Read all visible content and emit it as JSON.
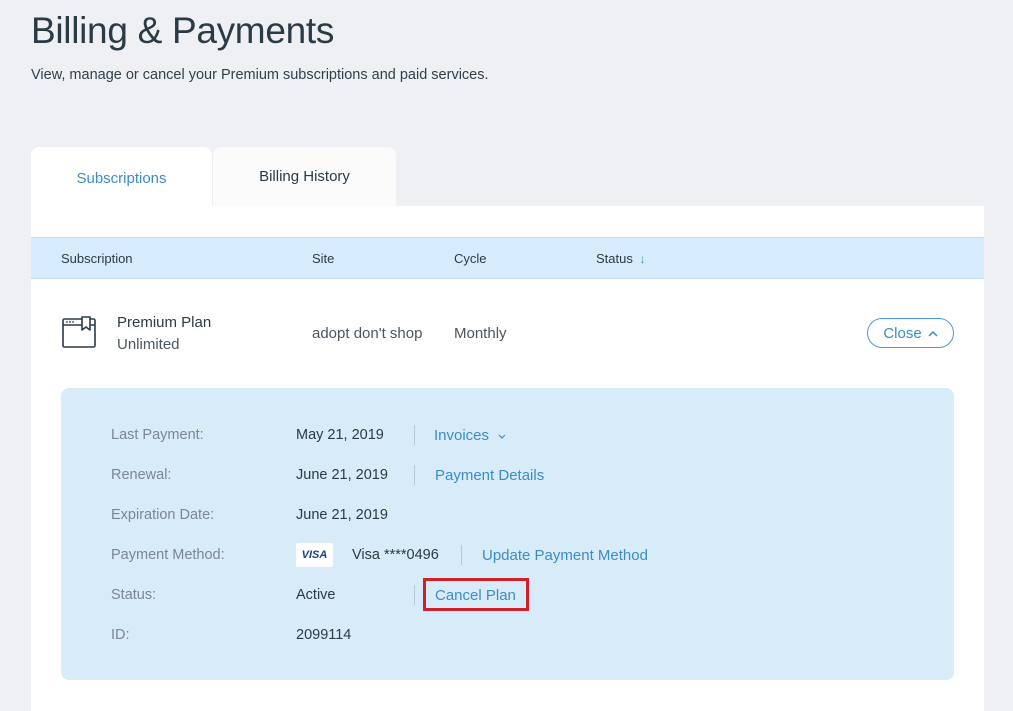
{
  "page": {
    "title": "Billing & Payments",
    "subtitle": "View, manage or cancel your Premium subscriptions and paid services."
  },
  "tabs": [
    {
      "label": "Subscriptions",
      "active": true
    },
    {
      "label": "Billing History",
      "active": false
    }
  ],
  "table": {
    "headers": {
      "subscription": "Subscription",
      "site": "Site",
      "cycle": "Cycle",
      "status": "Status",
      "status_sort_icon": "↓"
    },
    "row": {
      "icon": "browser-bookmark-icon",
      "plan_name": "Premium Plan",
      "plan_tier": "Unlimited",
      "site": "adopt don't shop",
      "cycle": "Monthly",
      "close_label": "Close"
    }
  },
  "details": {
    "last_payment_label": "Last Payment:",
    "last_payment_value": "May 21, 2019",
    "invoices_label": "Invoices",
    "renewal_label": "Renewal:",
    "renewal_value": "June 21, 2019",
    "payment_details_label": "Payment Details",
    "expiration_label": "Expiration Date:",
    "expiration_value": "June 21, 2019",
    "payment_method_label": "Payment Method:",
    "card_brand_badge": "VISA",
    "card_value": "Visa ****0496",
    "update_payment_label": "Update Payment Method",
    "status_label": "Status:",
    "status_value": "Active",
    "cancel_plan_label": "Cancel Plan",
    "id_label": "ID:",
    "id_value": "2099114"
  },
  "colors": {
    "link": "#3c8dc4",
    "header_bg": "#d6ebfb",
    "details_bg": "#d7ebf9",
    "highlight": "#d0202a"
  }
}
